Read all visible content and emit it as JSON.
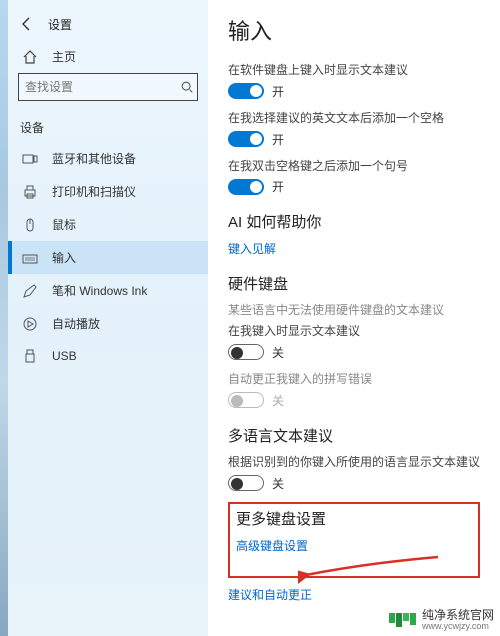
{
  "header": {
    "title": "设置",
    "home": "主页"
  },
  "search": {
    "placeholder": "查找设置"
  },
  "sidebar": {
    "section": "设备",
    "items": [
      {
        "label": "蓝牙和其他设备"
      },
      {
        "label": "打印机和扫描仪"
      },
      {
        "label": "鼠标"
      },
      {
        "label": "输入"
      },
      {
        "label": "笔和 Windows Ink"
      },
      {
        "label": "自动播放"
      },
      {
        "label": "USB"
      }
    ]
  },
  "main": {
    "title": "输入",
    "toggles": [
      {
        "desc": "在软件键盘上键入时显示文本建议",
        "on": true,
        "label": "开"
      },
      {
        "desc": "在我选择建议的英文文本后添加一个空格",
        "on": true,
        "label": "开"
      },
      {
        "desc": "在我双击空格键之后添加一个句号",
        "on": true,
        "label": "开"
      }
    ],
    "ai": {
      "heading": "AI 如何帮助你",
      "link": "键入见解"
    },
    "hw": {
      "heading": "硬件键盘",
      "note": "某些语言中无法使用硬件键盘的文本建议",
      "t1": {
        "desc": "在我键入时显示文本建议",
        "on": false,
        "label": "关"
      },
      "t2": {
        "desc": "自动更正我键入的拼写错误",
        "disabled": true,
        "label": "关"
      }
    },
    "multi": {
      "heading": "多语言文本建议",
      "desc": "根据识别到的你键入所使用的语言显示文本建议",
      "on": false,
      "label": "关"
    },
    "more": {
      "heading": "更多键盘设置",
      "link": "高级键盘设置"
    },
    "bottom_link": "建议和自动更正"
  },
  "watermark": {
    "brand": "纯净系统官网",
    "url": "www.ycwjzy.com"
  }
}
